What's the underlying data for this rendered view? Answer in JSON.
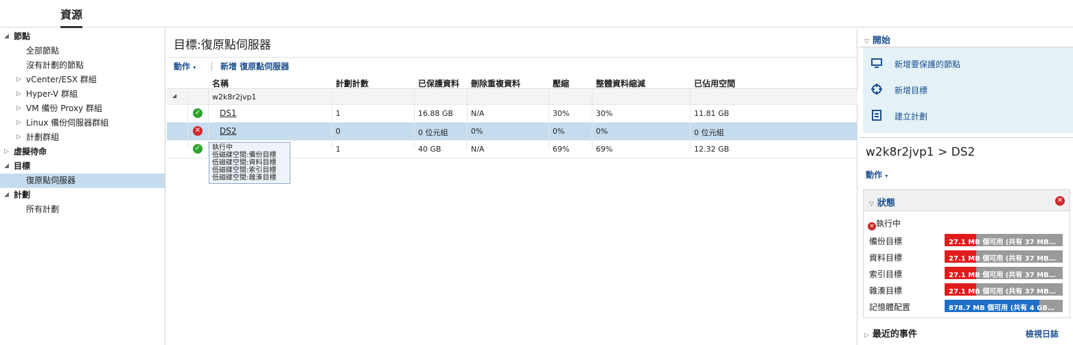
{
  "top_tab": "資源",
  "tree": [
    {
      "label": "節點",
      "level": 0,
      "arrow": "◢",
      "selected": false
    },
    {
      "label": "全部節點",
      "level": 1,
      "arrow": "",
      "selected": false
    },
    {
      "label": "沒有計劃的節點",
      "level": 1,
      "arrow": "",
      "selected": false
    },
    {
      "label": "vCenter/ESX 群組",
      "level": 1,
      "arrow": "▷",
      "selected": false
    },
    {
      "label": "Hyper-V 群組",
      "level": 1,
      "arrow": "▷",
      "selected": false
    },
    {
      "label": "VM 備份 Proxy 群組",
      "level": 1,
      "arrow": "▷",
      "selected": false
    },
    {
      "label": "Linux 備份伺服器群組",
      "level": 1,
      "arrow": "▷",
      "selected": false
    },
    {
      "label": "計劃群組",
      "level": 1,
      "arrow": "▷",
      "selected": false
    },
    {
      "label": "虛擬待命",
      "level": 0,
      "arrow": "▷",
      "selected": false
    },
    {
      "label": "目標",
      "level": 0,
      "arrow": "◢",
      "selected": false
    },
    {
      "label": "復原點伺服器",
      "level": 1,
      "arrow": "",
      "selected": true
    },
    {
      "label": "計劃",
      "level": 0,
      "arrow": "◢",
      "selected": false
    },
    {
      "label": "所有計劃",
      "level": 1,
      "arrow": "",
      "selected": false
    }
  ],
  "center": {
    "title": "目標:復原點伺服器",
    "toolbar": {
      "action_label": "動作",
      "add_label": "新增 復原點伺服器"
    },
    "columns": {
      "name": "名稱",
      "plan_count": "計劃計數",
      "protected": "已保護資料",
      "dedupe": "刪除重複資料",
      "compression": "壓縮",
      "overall": "整體資料縮減",
      "used": "已佔用空間"
    },
    "group": {
      "name": "w2k8r2jvp1"
    },
    "rows": [
      {
        "status": "ok",
        "name": "DS1",
        "plan_count": "1",
        "protected": "16.88 GB",
        "dedupe": "N/A",
        "compression": "30%",
        "overall": "30%",
        "used": "11.81 GB"
      },
      {
        "status": "err",
        "name": "DS2",
        "plan_count": "0",
        "protected": "0 位元組",
        "dedupe": "0%",
        "compression": "0%",
        "overall": "0%",
        "used": "0 位元組"
      },
      {
        "status": "ok",
        "name": "",
        "plan_count": "1",
        "protected": "40 GB",
        "dedupe": "N/A",
        "compression": "69%",
        "overall": "69%",
        "used": "12.32 GB"
      }
    ],
    "tooltip": [
      "執行中",
      "低磁碟空間:備份目標",
      "低磁碟空間:資料目標",
      "低磁碟空間:索引目標",
      "低磁碟空間:雜湊目標"
    ]
  },
  "right": {
    "start_label": "開始",
    "quick_links": [
      {
        "icon": "monitor-icon",
        "label": "新增要保護的節點"
      },
      {
        "icon": "target-icon",
        "label": "新增目標"
      },
      {
        "icon": "plan-icon",
        "label": "建立計劃"
      }
    ],
    "node_title": "w2k8r2jvp1 > DS2",
    "action_label": "動作",
    "status_label": "狀態",
    "state": "執行中",
    "capacity": [
      {
        "label": "備份目標",
        "text": "27.1 MB 個可用 (共有 37 MB…",
        "fill_pct": 27,
        "color": "#e01b1b"
      },
      {
        "label": "資料目標",
        "text": "27.1 MB 個可用 (共有 37 MB…",
        "fill_pct": 27,
        "color": "#e01b1b"
      },
      {
        "label": "索引目標",
        "text": "27.1 MB 個可用 (共有 37 MB…",
        "fill_pct": 27,
        "color": "#e01b1b"
      },
      {
        "label": "雜湊目標",
        "text": "27.1 MB 個可用 (共有 37 MB…",
        "fill_pct": 27,
        "color": "#e01b1b"
      },
      {
        "label": "記憶體配置",
        "text": "878.7 MB 個可用 (共有 4 GB…",
        "fill_pct": 80,
        "color": "#1e6fc8"
      }
    ],
    "recent_label": "最近的事件",
    "view_log_label": "檢視日誌"
  }
}
